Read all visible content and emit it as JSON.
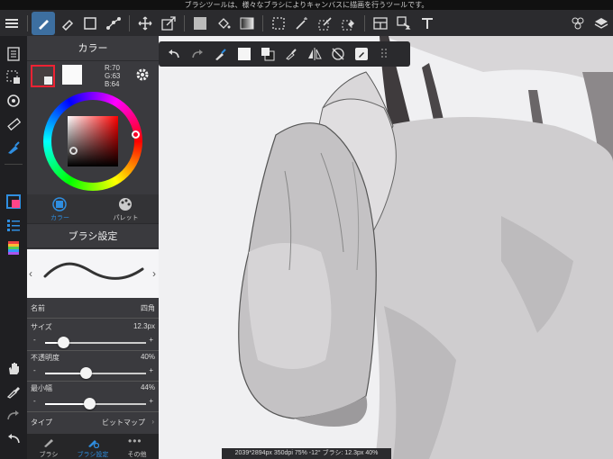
{
  "status_text": "ブラシツールは、様々なブラシによりキャンバスに描画を行うツールです。",
  "color_panel": {
    "title": "カラー",
    "rgb": {
      "r": "R:70",
      "g": "G:63",
      "b": "B:64"
    },
    "tabs": [
      {
        "label": "カラー"
      },
      {
        "label": "パレット"
      }
    ]
  },
  "brush_panel": {
    "title": "ブラシ設定",
    "name_label": "名前",
    "name_value": "四角",
    "size": {
      "label": "サイズ",
      "value": "12.3px",
      "level": 0.18
    },
    "opacity": {
      "label": "不透明度",
      "value": "40%",
      "level": 0.4
    },
    "min_width": {
      "label": "最小幅",
      "value": "44%",
      "level": 0.44
    },
    "type_label": "タイプ",
    "type_value": "ビットマップ",
    "minus": "-",
    "plus": "+"
  },
  "bottom_tabs": [
    {
      "label": "ブラシ"
    },
    {
      "label": "ブラシ設定"
    },
    {
      "label": "その他"
    }
  ],
  "info_bar": "2039*2894px 350dpi 75% -12° ブラシ: 12.3px 40%",
  "colors": {
    "accent": "#2f8ee0",
    "panel_bg": "#3a3a3e",
    "primary_color": "#463f40"
  }
}
